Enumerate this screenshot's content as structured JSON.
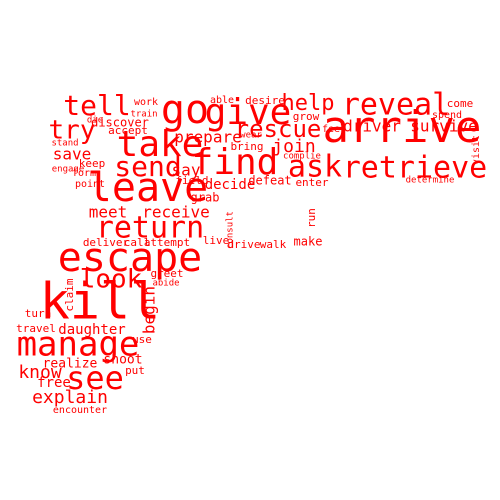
{
  "word_color": "#ff0000",
  "background": "#ffffff",
  "words": [
    "arrive",
    "go",
    "give",
    "take",
    "reveal",
    "tell",
    "ask",
    "retrieve",
    "find",
    "leave",
    "kill",
    "manage",
    "escape",
    "look",
    "return",
    "send",
    "rescue",
    "help",
    "try",
    "see",
    "know",
    "save",
    "explain",
    "meet",
    "receive",
    "driver",
    "survive",
    "join",
    "begin",
    "free",
    "daughter",
    "prepare",
    "decide",
    "say",
    "realize",
    "shoot",
    "grab",
    "drive",
    "walk",
    "make",
    "run",
    "defeat",
    "enter",
    "bring",
    "desire",
    "grow",
    "come",
    "spend",
    "determine",
    "visit",
    "discover",
    "accept",
    "keep",
    "field",
    "live",
    "deliver",
    "call",
    "attempt",
    "greet",
    "travel",
    "turn",
    "use",
    "encounter",
    "claim",
    "put",
    "point",
    "form",
    "engage",
    "die",
    "stand",
    "wear",
    "complie",
    "consult",
    "abide",
    "train",
    "work",
    "able",
    "feel"
  ]
}
